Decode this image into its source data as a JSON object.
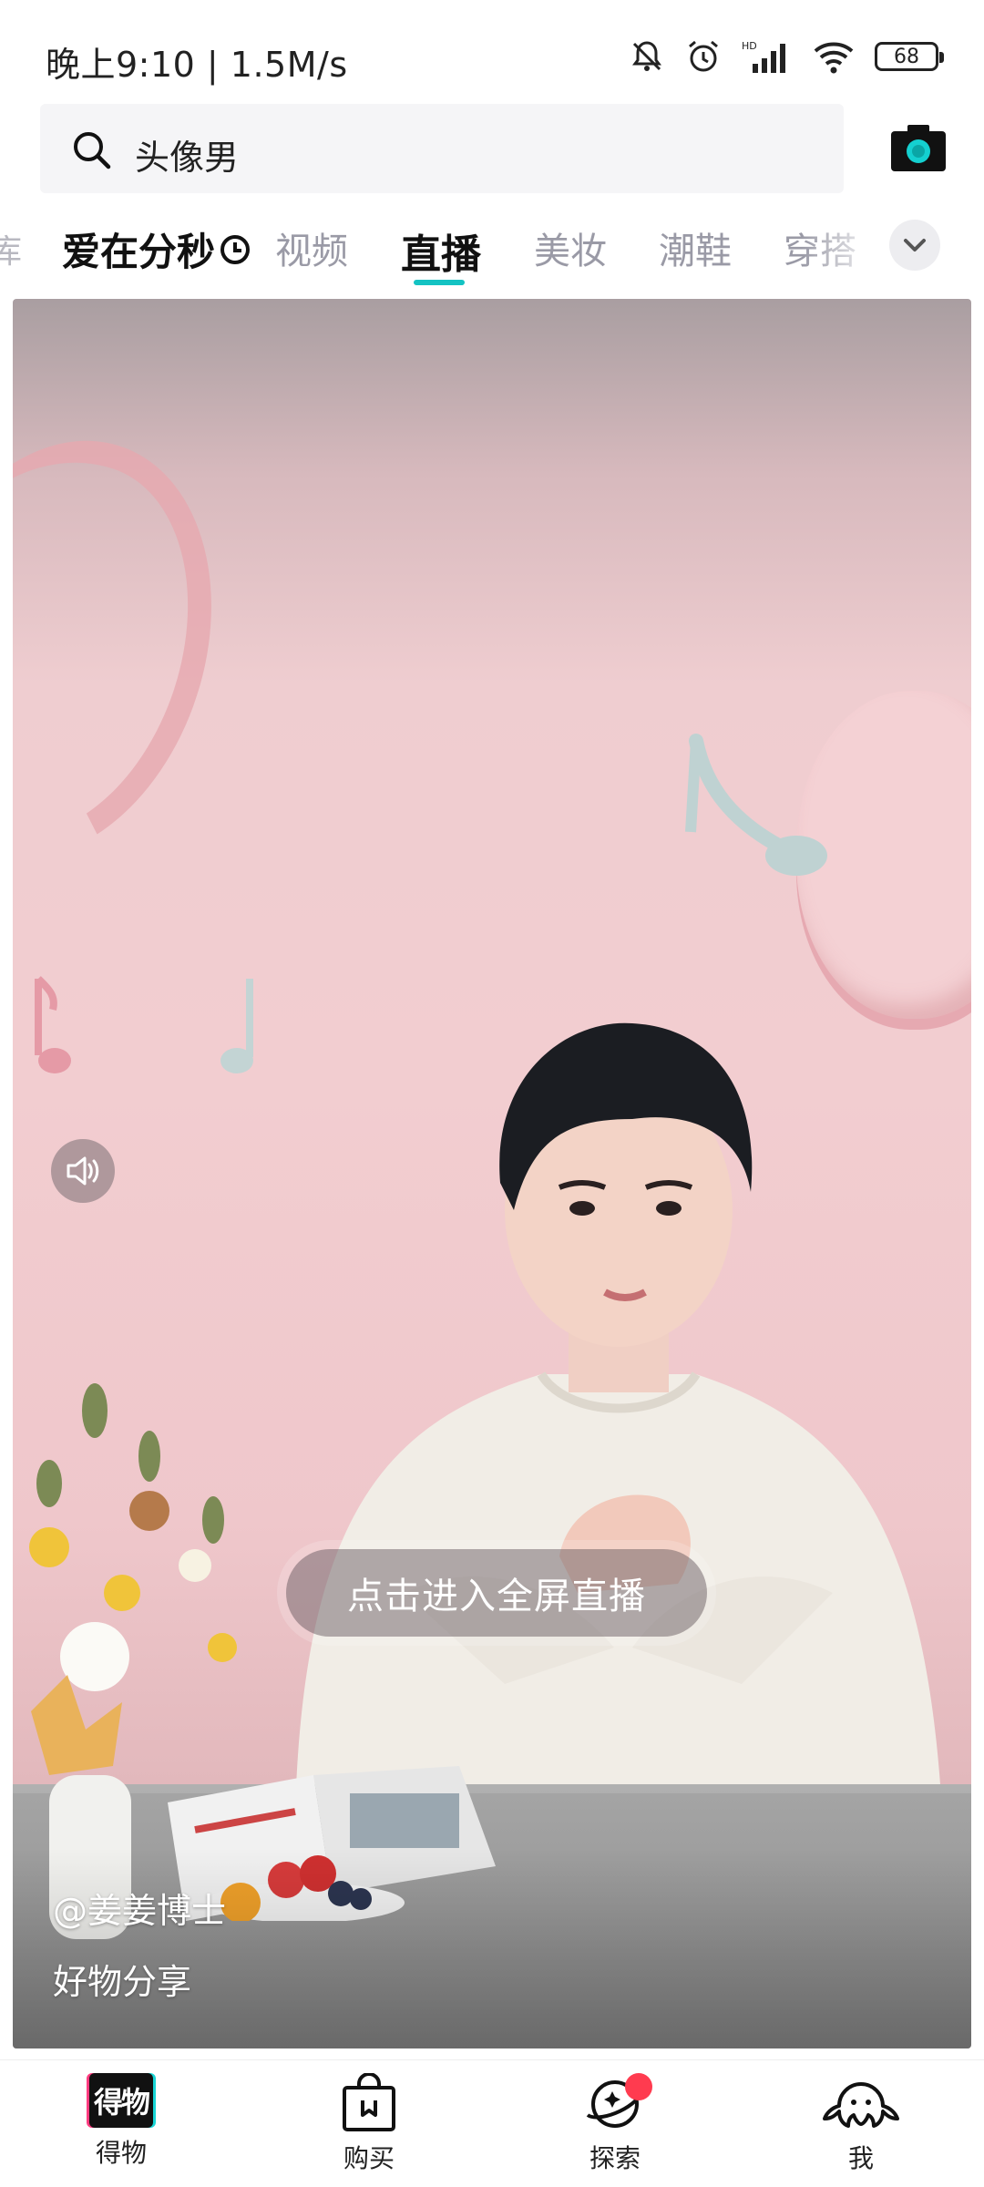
{
  "status_bar": {
    "time": "晚上9:10 | 1.5M/s",
    "battery": "68",
    "icons": [
      "bell-off-icon",
      "alarm-icon",
      "hd-signal-icon",
      "wifi-icon",
      "battery-icon"
    ]
  },
  "search": {
    "query": "头像男",
    "icon": "search-icon",
    "camera_icon": "camera-icon"
  },
  "tabs": {
    "cut_left": "库",
    "brand": "爱在分秒",
    "items": [
      "视频",
      "直播",
      "美妆",
      "潮鞋",
      "穿搭"
    ],
    "active": "直播",
    "more_icon": "chevron-down-icon"
  },
  "live": {
    "enter_label": "点击进入全屏直播",
    "host": "@姜姜博士",
    "tag": "好物分享",
    "sound_icon": "speaker-icon"
  },
  "bottom_nav": {
    "items": [
      {
        "label": "得物",
        "icon": "dewu-logo-icon"
      },
      {
        "label": "购买",
        "icon": "shopping-bag-icon"
      },
      {
        "label": "探索",
        "icon": "planet-icon",
        "badge": true
      },
      {
        "label": "我",
        "icon": "octopus-icon"
      }
    ],
    "logo_text": "得物"
  },
  "colors": {
    "accent": "#14c3c3",
    "badge": "#ff3b4f",
    "card_bg": "#efcdd0"
  }
}
